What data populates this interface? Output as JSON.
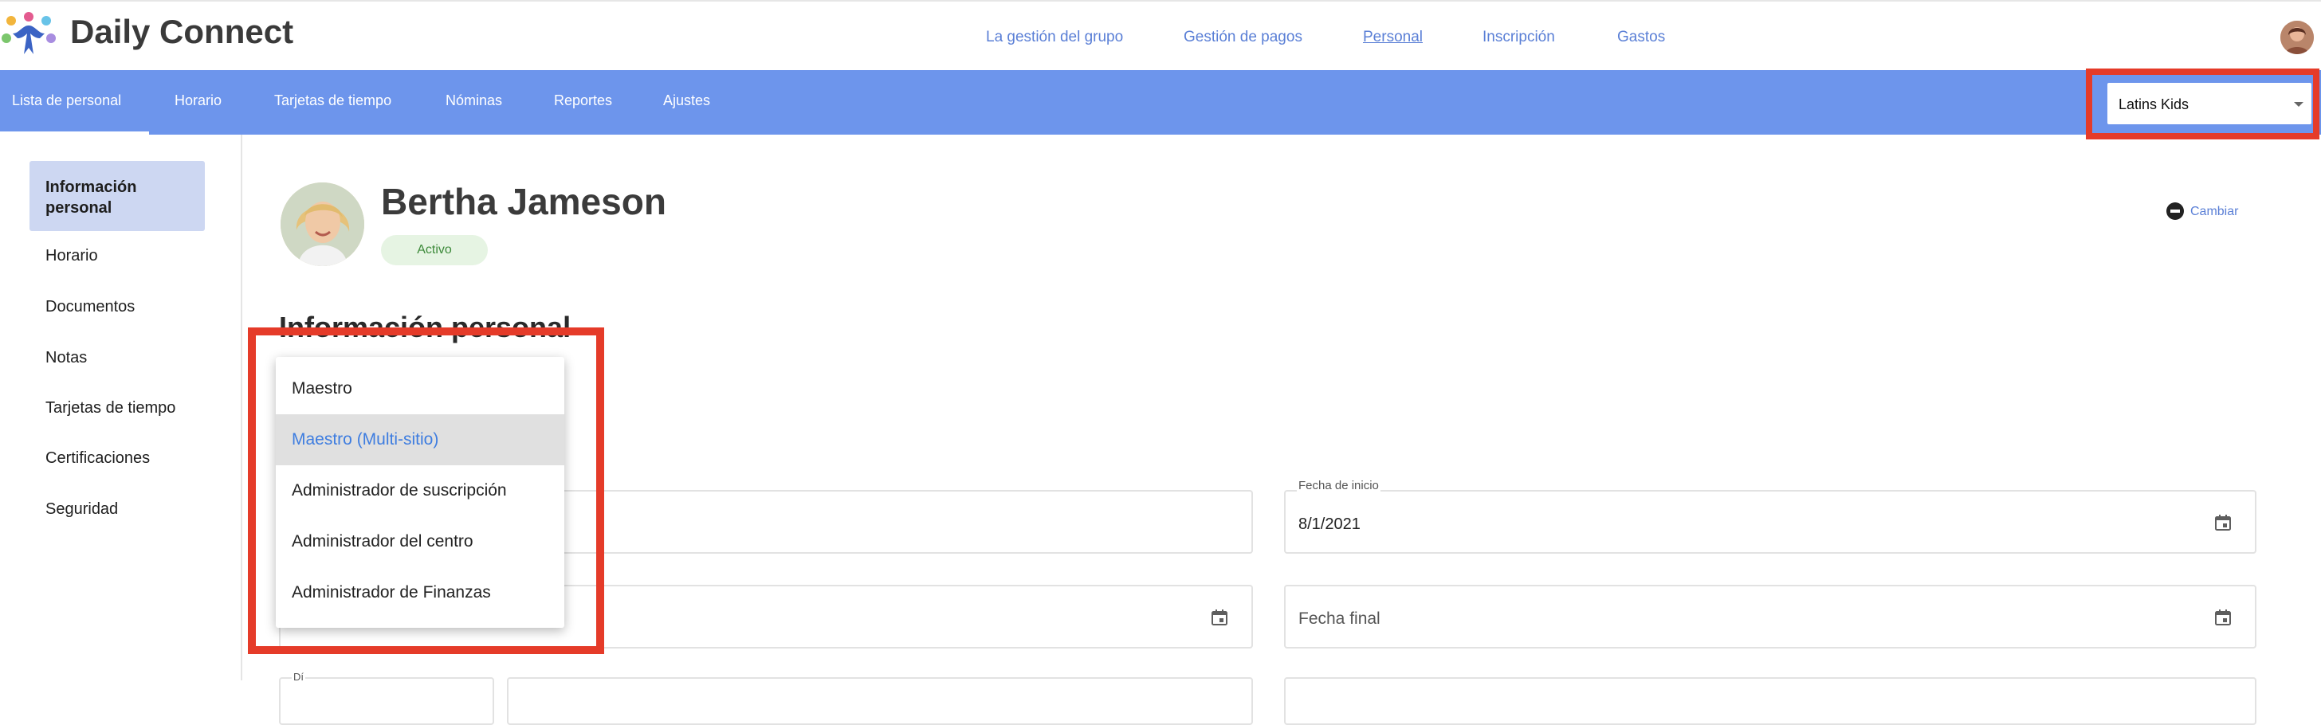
{
  "app": {
    "brand": "Daily Connect"
  },
  "topnav": {
    "items": [
      {
        "label": "La gestión del grupo"
      },
      {
        "label": "Gestión de pagos"
      },
      {
        "label": "Personal"
      },
      {
        "label": "Inscripción"
      },
      {
        "label": "Gastos"
      }
    ],
    "active": "Personal"
  },
  "subnav": {
    "tabs": [
      {
        "label": "Lista de personal"
      },
      {
        "label": "Horario"
      },
      {
        "label": "Tarjetas de tiempo"
      },
      {
        "label": "Nóminas"
      },
      {
        "label": "Reportes"
      },
      {
        "label": "Ajustes"
      }
    ],
    "active": "Lista de personal",
    "site_select": {
      "value": "Latins Kids"
    }
  },
  "sidebar": {
    "items": [
      {
        "label": "Información personal"
      },
      {
        "label": "Horario"
      },
      {
        "label": "Documentos"
      },
      {
        "label": "Notas"
      },
      {
        "label": "Tarjetas de tiempo"
      },
      {
        "label": "Certificaciones"
      },
      {
        "label": "Seguridad"
      }
    ],
    "active": "Información personal"
  },
  "profile": {
    "name": "Bertha Jameson",
    "status": "Activo",
    "change_label": "Cambiar"
  },
  "section": {
    "title": "Información personal"
  },
  "form": {
    "start_date": {
      "label": "Fecha de inicio",
      "value": "8/1/2021"
    },
    "end_date": {
      "placeholder": "Fecha final"
    },
    "partial_label": "Dí"
  },
  "role_dropdown": {
    "options": [
      {
        "label": "Maestro"
      },
      {
        "label": "Maestro (Multi-sitio)"
      },
      {
        "label": "Administrador de suscripción"
      },
      {
        "label": "Administrador del centro"
      },
      {
        "label": "Administrador de Finanzas"
      }
    ],
    "highlighted": "Maestro (Multi-sitio)"
  },
  "colors": {
    "accent": "#6d95ec",
    "link": "#5a7fd6",
    "annotation_red": "#e53b29",
    "status_green": "#3d8a3a"
  },
  "icons": [
    "logo-people-icon",
    "calendar-icon",
    "change-icon",
    "caret-down-icon"
  ]
}
